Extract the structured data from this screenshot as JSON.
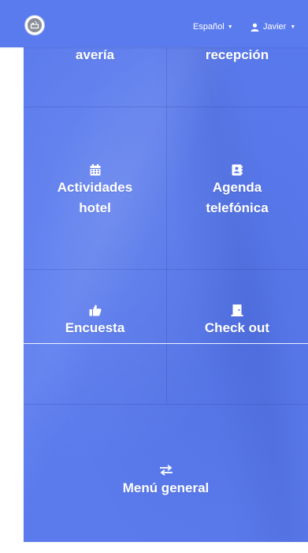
{
  "header": {
    "language_label": "Español",
    "user_name": "Javier"
  },
  "tiles": {
    "averia": {
      "label": "avería",
      "icon": "wrench-icon"
    },
    "recepcion": {
      "label": "recepción",
      "icon": "bell-icon"
    },
    "actividades": {
      "line1": "Actividades",
      "line2": "hotel",
      "icon": "calendar-icon"
    },
    "agenda": {
      "line1": "Agenda",
      "line2": "telefónica",
      "icon": "address-book-icon"
    },
    "encuesta": {
      "label": "Encuesta",
      "icon": "thumbs-up-icon"
    },
    "checkout": {
      "label": "Check out",
      "icon": "door-icon"
    },
    "menu": {
      "label": "Menú general",
      "icon": "exchange-arrows-icon"
    }
  },
  "colors": {
    "primary": "#5a7bee",
    "text": "#ffffff"
  }
}
